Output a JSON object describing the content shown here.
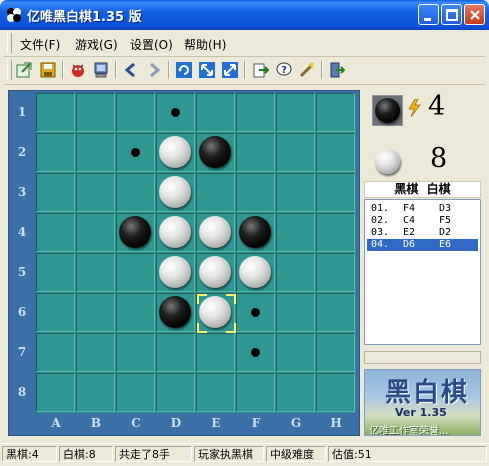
{
  "window": {
    "title": "亿唯黑白棋1.35 版"
  },
  "menu": [
    {
      "label": "文件(F)"
    },
    {
      "label": "游戏(G)"
    },
    {
      "label": "设置(O)"
    },
    {
      "label": "帮助(H)"
    }
  ],
  "toolbar_icons": [
    "new-game-icon",
    "save-icon",
    "bug-icon",
    "computer-icon",
    "undo-arrow-icon",
    "redo-arrow-icon",
    "refresh-icon",
    "resize-icon",
    "resize-alt-icon",
    "export-icon",
    "help-icon",
    "tools-icon",
    "exit-icon"
  ],
  "board": {
    "rows": [
      "1",
      "2",
      "3",
      "4",
      "5",
      "6",
      "7",
      "8"
    ],
    "cols": [
      "A",
      "B",
      "C",
      "D",
      "E",
      "F",
      "G",
      "H"
    ],
    "pieces": [
      {
        "cell": "D2",
        "color": "white"
      },
      {
        "cell": "E2",
        "color": "black"
      },
      {
        "cell": "D3",
        "color": "white"
      },
      {
        "cell": "C4",
        "color": "black"
      },
      {
        "cell": "D4",
        "color": "white"
      },
      {
        "cell": "E4",
        "color": "white"
      },
      {
        "cell": "F4",
        "color": "black"
      },
      {
        "cell": "D5",
        "color": "white"
      },
      {
        "cell": "E5",
        "color": "white"
      },
      {
        "cell": "F5",
        "color": "white"
      },
      {
        "cell": "D6",
        "color": "black"
      },
      {
        "cell": "E6",
        "color": "white"
      }
    ],
    "hints": [
      "D1",
      "C2",
      "F6",
      "F7"
    ],
    "last_move": "E6"
  },
  "score": {
    "black": "4",
    "white": "8"
  },
  "moves": {
    "header": "黑棋  白棋",
    "rows": [
      {
        "num": "01.",
        "black": "F4",
        "white": "D3"
      },
      {
        "num": "02.",
        "black": "C4",
        "white": "F5"
      },
      {
        "num": "03.",
        "black": "E2",
        "white": "D2"
      },
      {
        "num": "04.",
        "black": "D6",
        "white": "E6"
      }
    ],
    "selected_index": 3
  },
  "logo": {
    "title": "黑白棋",
    "version": "Ver 1.35",
    "studio": "亿唯工作室荣誉..."
  },
  "status": {
    "black_count": "黑棋:4",
    "white_count": "白棋:8",
    "moves_played": "共走了8手",
    "player_side": "玩家执黑棋",
    "difficulty": "中级难度",
    "evaluation": "估值:51"
  },
  "colors": {
    "board_cell": "#2f9792",
    "board_frame": "#3a6fa8",
    "selection": "#316ac5",
    "titlebar": "#0a5ce6"
  }
}
